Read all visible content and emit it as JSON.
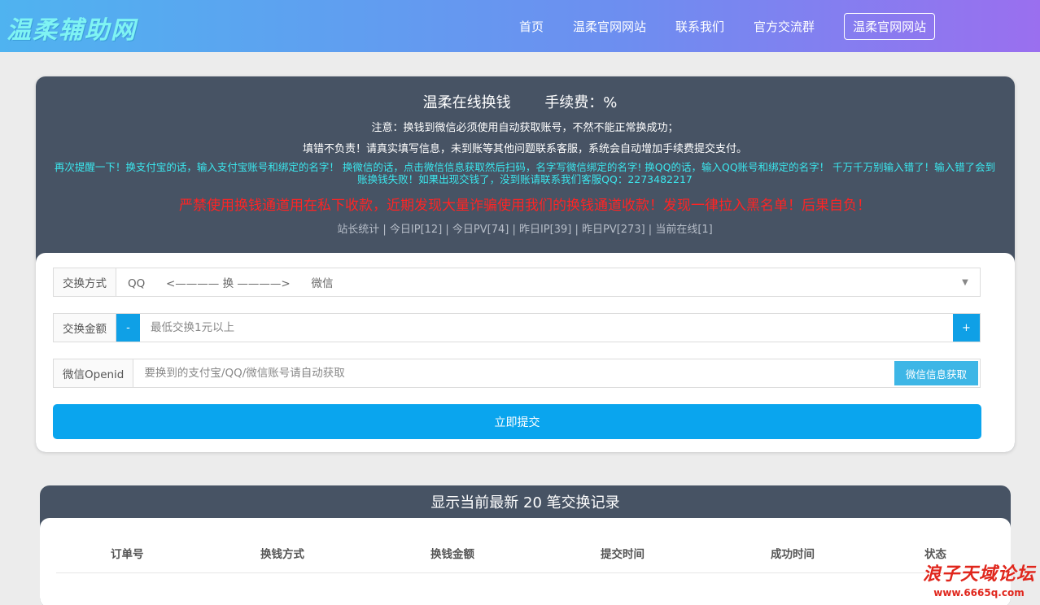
{
  "header": {
    "logo": "温柔辅助网",
    "nav": [
      "首页",
      "温柔官网网站",
      "联系我们",
      "官方交流群"
    ],
    "nav_button": "温柔官网网站"
  },
  "panel": {
    "title": "温柔在线换钱",
    "fee": "手续费：%",
    "note1": "注意：换钱到微信必须使用自动获取账号，不然不能正常换成功；",
    "note2": "填错不负责！请真实填写信息，未到账等其他问题联系客服，系统会自动增加手续费提交支付。",
    "note3": "再次提醒一下！换支付宝的话，输入支付宝账号和绑定的名字！ 换微信的话，点击微信信息获取然后扫码，名字写微信绑定的名字! 换QQ的话，输入QQ账号和绑定的名字！ 千万千万别输入错了！输入错了会到账换钱失败！如果出现交钱了，没到账请联系我们客服QQ：2273482217",
    "note4": "严禁使用换钱通道用在私下收款，近期发现大量诈骗使用我们的换钱通道收款！发现一律拉入黑名单！后果自负！",
    "stats": "站长统计 | 今日IP[12] | 今日PV[74] | 昨日IP[39] | 昨日PV[273] | 当前在线[1]"
  },
  "form": {
    "method_label": "交换方式",
    "method_value": "QQ      <———— 换 ————>      微信",
    "amount_label": "交换金额",
    "minus": "-",
    "plus": "+",
    "amount_placeholder": "最低交换1元以上",
    "openid_label": "微信Openid",
    "openid_placeholder": "要换到的支付宝/QQ/微信账号请自动获取",
    "get_info": "微信信息获取",
    "submit": "立即提交"
  },
  "records": {
    "title": "显示当前最新 20 笔交换记录",
    "columns": [
      "订单号",
      "换钱方式",
      "换钱金额",
      "提交时间",
      "成功时间",
      "状态"
    ]
  },
  "watermark": {
    "name": "浪子天域论坛",
    "url": "www.6665q.com"
  }
}
